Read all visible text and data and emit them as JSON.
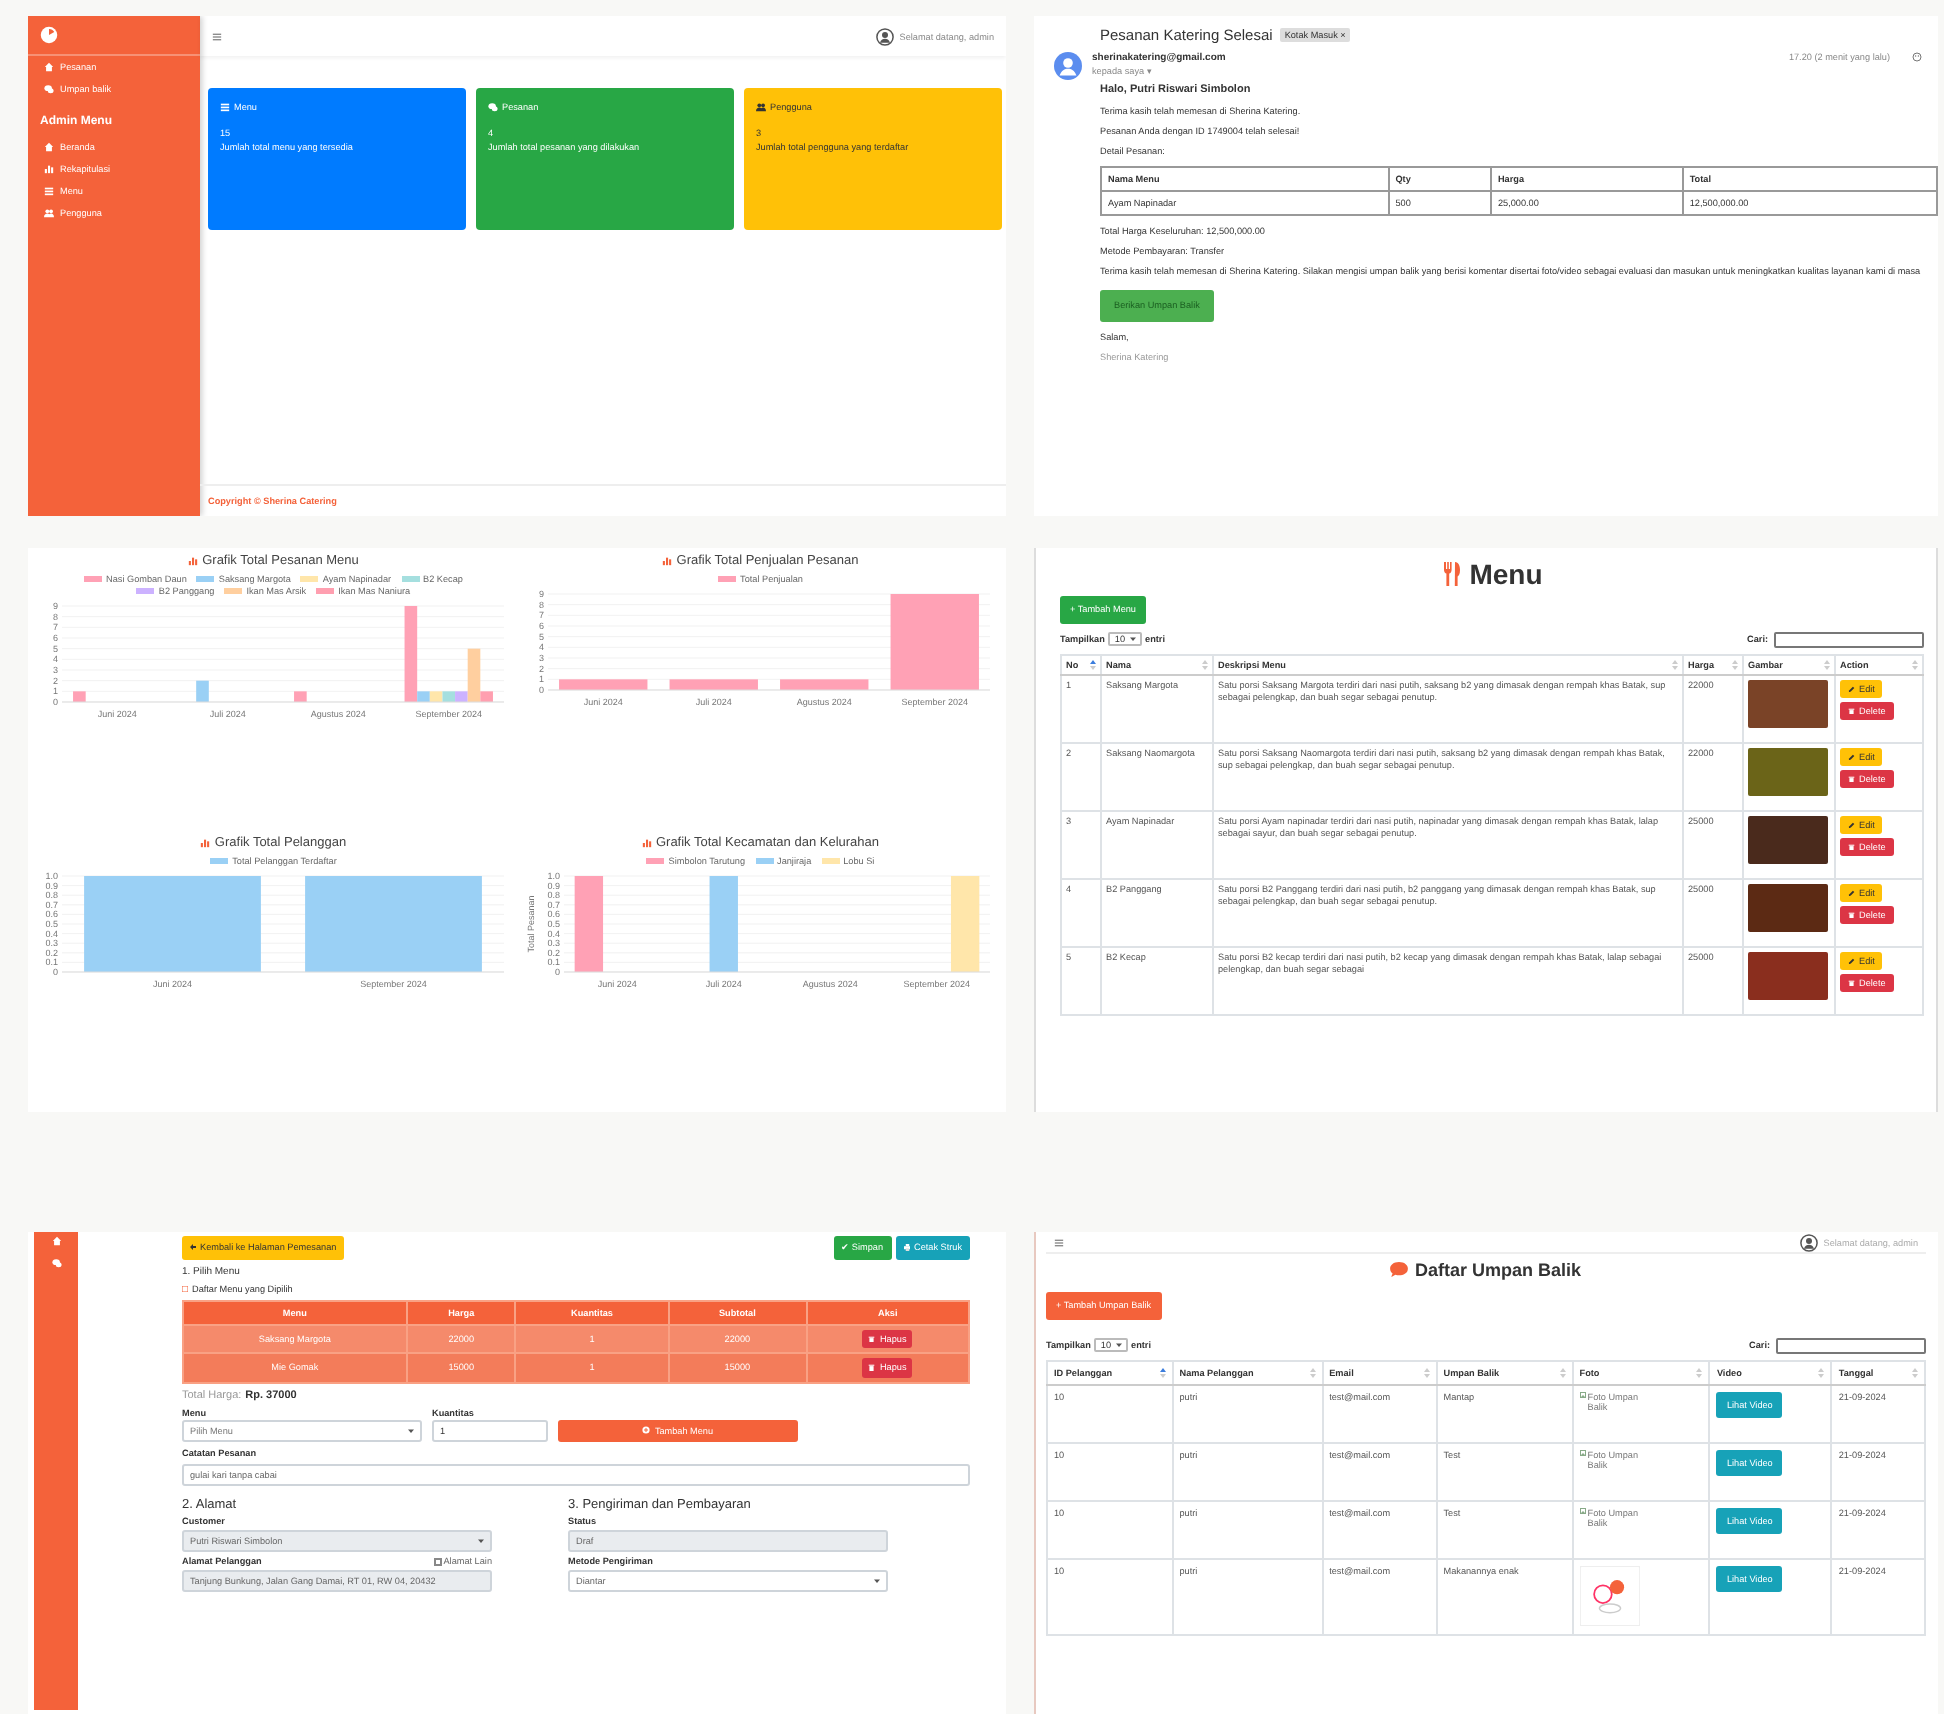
{
  "dashboard": {
    "sidebar": {
      "top_items": [
        "Pesanan",
        "Umpan balik"
      ],
      "section_title": "Admin Menu",
      "admin_items": [
        "Beranda",
        "Rekapitulasi",
        "Menu",
        "Pengguna"
      ]
    },
    "greeting": "Selamat datang, admin",
    "cards": [
      {
        "title": "Menu",
        "value": "15",
        "description": "Jumlah total menu yang tersedia",
        "color": "#007bff"
      },
      {
        "title": "Pesanan",
        "value": "4",
        "description": "Jumlah total pesanan yang dilakukan",
        "color": "#28a745"
      },
      {
        "title": "Pengguna",
        "value": "3",
        "description": "Jumlah total pengguna yang terdaftar",
        "color": "#ffc107"
      }
    ],
    "footer": "Copyright © Sherina Catering"
  },
  "email": {
    "subject": "Pesanan Katering Selesai",
    "label": "Kotak Masuk ×",
    "sender": "sherinakatering@gmail.com",
    "recipient": "kepada saya ▾",
    "time": "17.20 (2 menit yang lalu)",
    "greeting": "Halo, Putri Riswari Simbolon",
    "lines": [
      "Terima kasih telah memesan di Sherina Katering.",
      "Pesanan Anda dengan ID 1749004 telah selesai!",
      "Detail Pesanan:"
    ],
    "table": {
      "columns": [
        "Nama Menu",
        "Qty",
        "Harga",
        "Total"
      ],
      "rows": [
        [
          "Ayam Napinadar",
          "500",
          "25,000.00",
          "12,500,000.00"
        ]
      ]
    },
    "after_lines": [
      "Total Harga Keseluruhan: 12,500,000.00",
      "Metode Pembayaran: Transfer",
      "Terima kasih telah memesan di Sherina Katering. Silakan mengisi umpan balik yang berisi komentar disertai foto/video sebagai evaluasi dan masukan untuk meningkatkan kualitas layanan kami di masa"
    ],
    "button": "Berikan Umpan Balik",
    "closing": "Salam,",
    "signature": "Sherina Katering"
  },
  "charts": [
    {
      "chart_data": {
        "type": "bar",
        "title": "Grafik Total Pesanan Menu",
        "categories": [
          "Juni 2024",
          "Juli 2024",
          "Agustus 2024",
          "September 2024"
        ],
        "series": [
          {
            "name": "Nasi Gomban Daun",
            "color": "#ffa1b5",
            "values": [
              1,
              null,
              1,
              9
            ]
          },
          {
            "name": "Saksang Margota",
            "color": "#9ad0f5",
            "values": [
              null,
              2,
              null,
              1
            ]
          },
          {
            "name": "Ayam Napinadar",
            "color": "#ffe6aa",
            "values": [
              null,
              null,
              null,
              1
            ]
          },
          {
            "name": "B2 Kecap",
            "color": "#a5dfdf",
            "values": [
              null,
              null,
              null,
              1
            ]
          },
          {
            "name": "B2 Panggang",
            "color": "#ccb2ff",
            "values": [
              null,
              null,
              null,
              1
            ]
          },
          {
            "name": "Ikan Mas Arsik",
            "color": "#ffcf9f",
            "values": [
              null,
              null,
              null,
              5
            ]
          },
          {
            "name": "Ikan Mas Naniura",
            "color": "#ff9fb0",
            "values": [
              null,
              null,
              null,
              1
            ]
          }
        ],
        "ylim": [
          0,
          9
        ],
        "yticks": [
          0,
          1,
          2,
          3,
          4,
          5,
          6,
          7,
          8,
          9
        ],
        "legend": "top",
        "grid": true
      }
    },
    {
      "chart_data": {
        "type": "bar",
        "title": "Grafik Total Penjualan Pesanan",
        "categories": [
          "Juni 2024",
          "Juli 2024",
          "Agustus 2024",
          "September 2024"
        ],
        "series": [
          {
            "name": "Total Penjualan",
            "color": "#ffa1b5",
            "values": [
              1,
              1,
              1,
              9
            ]
          }
        ],
        "ylim": [
          0,
          9
        ],
        "yticks": [
          0,
          1,
          2,
          3,
          4,
          5,
          6,
          7,
          8,
          9
        ],
        "legend": "top",
        "grid": true
      }
    },
    {
      "chart_data": {
        "type": "bar",
        "title": "Grafik Total Pelanggan",
        "categories": [
          "Juni 2024",
          "September 2024"
        ],
        "series": [
          {
            "name": "Total Pelanggan Terdaftar",
            "color": "#9ad0f5",
            "values": [
              1,
              1
            ]
          }
        ],
        "ylim": [
          0,
          1
        ],
        "yticks": [
          0,
          0.1,
          0.2,
          0.3,
          0.4,
          0.5,
          0.6,
          0.7,
          0.8,
          0.9,
          {
            "value": 1,
            "label": "1.0"
          }
        ],
        "legend": "top",
        "grid": true
      }
    },
    {
      "chart_data": {
        "type": "bar",
        "title": "Grafik Total Kecamatan dan Kelurahan",
        "ylabel": "Total Pesanan",
        "categories": [
          "Juni 2024",
          "Juli 2024",
          "Agustus 2024",
          "September 2024"
        ],
        "series": [
          {
            "name": "Simbolon Tarutung",
            "color": "#ffa1b5",
            "values": [
              1,
              null,
              null,
              null
            ]
          },
          {
            "name": "Janjiraja",
            "color": "#9ad0f5",
            "values": [
              null,
              1,
              null,
              null
            ]
          },
          {
            "name": "Lobu Si",
            "color": "#ffe6aa",
            "values": [
              null,
              null,
              null,
              1
            ]
          }
        ],
        "ylim": [
          0,
          1
        ],
        "yticks": [
          0,
          0.1,
          0.2,
          0.3,
          0.4,
          0.5,
          0.6,
          0.7,
          0.8,
          0.9,
          {
            "value": 1,
            "label": "1.0"
          }
        ],
        "legend": "top",
        "grid": true
      }
    }
  ],
  "menu_page": {
    "title": "Menu",
    "add_button": "+ Tambah Menu",
    "show_label": "Tampilkan",
    "page_size": "10",
    "entries_label": "entri",
    "search_label": "Cari:",
    "columns": [
      {
        "label": "No",
        "sorted": true
      },
      {
        "label": "Nama",
        "sorted": false
      },
      {
        "label": "Deskripsi Menu",
        "sorted": false
      },
      {
        "label": "Harga",
        "sorted": false
      },
      {
        "label": "Gambar",
        "sorted": false
      },
      {
        "label": "Action",
        "sorted": false
      }
    ],
    "rows": [
      {
        "no": "1",
        "name": "Saksang Margota",
        "description": "Satu porsi Saksang Margota terdiri dari nasi putih, saksang b2 yang dimasak dengan rempah khas Batak, sup sebagai pelengkap, dan buah segar sebagai penutup.",
        "price": "22000",
        "edit": "Edit",
        "delete": "Delete"
      },
      {
        "no": "2",
        "name": "Saksang Naomargota",
        "description": "Satu porsi Saksang Naomargota terdiri dari nasi putih, saksang b2 yang dimasak dengan rempah khas Batak, sup sebagai pelengkap, dan buah segar sebagai penutup.",
        "price": "22000",
        "edit": "Edit",
        "delete": "Delete"
      },
      {
        "no": "3",
        "name": "Ayam Napinadar",
        "description": "Satu porsi Ayam napinadar terdiri dari nasi putih, napinadar yang dimasak dengan rempah khas Batak, lalap sebagai sayur, dan buah segar sebagai penutup.",
        "price": "25000",
        "edit": "Edit",
        "delete": "Delete"
      },
      {
        "no": "4",
        "name": "B2 Panggang",
        "description": "Satu porsi B2 Panggang terdiri dari nasi putih, b2 panggang yang dimasak dengan rempah khas Batak, sup sebagai pelengkap, dan buah segar sebagai penutup.",
        "price": "25000",
        "edit": "Edit",
        "delete": "Delete"
      },
      {
        "no": "5",
        "name": "B2 Kecap",
        "description": "Satu porsi B2 kecap terdiri dari nasi putih, b2 kecap yang dimasak dengan rempah khas Batak, lalap sebagai pelengkap, dan buah segar sebagai",
        "price": "25000",
        "edit": "Edit",
        "delete": "Delete"
      }
    ]
  },
  "order_form": {
    "back_button": "Kembali ke Halaman Pemesanan",
    "save_button": "✔ Simpan",
    "print_button": "Cetak Struk",
    "section_1": "1. Pilih Menu",
    "selected_title": "Daftar Menu yang Dipilih",
    "table": {
      "columns": [
        "Menu",
        "Harga",
        "Kuantitas",
        "Subtotal",
        "Aksi"
      ],
      "rows": [
        {
          "menu": "Saksang Margota",
          "price": "22000",
          "qty": "1",
          "subtotal": "22000",
          "action": "Hapus"
        },
        {
          "menu": "Mie Gomak",
          "price": "15000",
          "qty": "1",
          "subtotal": "15000",
          "action": "Hapus"
        }
      ]
    },
    "total_label": "Total Harga:",
    "total_value": "Rp. 37000",
    "menu_label": "Menu",
    "menu_select": "Pilih Menu",
    "qty_label": "Kuantitas",
    "qty_value": "1",
    "add_button": "Tambah Menu",
    "note_label": "Catatan Pesanan",
    "note_value": "gulai kari tanpa cabai",
    "section_2": "2. Alamat",
    "customer_label": "Customer",
    "customer_value": "Putri Riswari Simbolon",
    "address_label": "Alamat Pelanggan",
    "other_address": {
      "label": "Alamat Lain",
      "checked": false
    },
    "address_value": "Tanjung Bunkung, Jalan Gang Damai, RT 01, RW 04, 20432",
    "section_3": "3. Pengiriman dan Pembayaran",
    "status_label": "Status",
    "status_value": "Draf",
    "shipping_label": "Metode Pengiriman",
    "shipping_value": "Diantar"
  },
  "feedback_page": {
    "greeting": "Selamat datang, admin",
    "title": "Daftar Umpan Balik",
    "add_button": "+ Tambah Umpan Balik",
    "show_label": "Tampilkan",
    "page_size": "10",
    "entries_label": "entri",
    "search_label": "Cari:",
    "columns": [
      {
        "label": "ID Pelanggan",
        "sorted": true
      },
      {
        "label": "Nama Pelanggan",
        "sorted": false
      },
      {
        "label": "Email",
        "sorted": false
      },
      {
        "label": "Umpan Balik",
        "sorted": false
      },
      {
        "label": "Foto",
        "sorted": false
      },
      {
        "label": "Video",
        "sorted": false
      },
      {
        "label": "Tanggal",
        "sorted": false
      }
    ],
    "rows": [
      {
        "id": "10",
        "name": "putri",
        "email": "test@mail.com",
        "feedback": "Mantap",
        "photo": {
          "kind": "broken",
          "alt": "Foto Umpan Balik"
        },
        "video_button": "Lihat Video",
        "date": "21-09-2024"
      },
      {
        "id": "10",
        "name": "putri",
        "email": "test@mail.com",
        "feedback": "Test",
        "photo": {
          "kind": "broken",
          "alt": "Foto Umpan Balik"
        },
        "video_button": "Lihat Video",
        "date": "21-09-2024"
      },
      {
        "id": "10",
        "name": "putri",
        "email": "test@mail.com",
        "feedback": "Test",
        "photo": {
          "kind": "broken",
          "alt": "Foto Umpan Balik"
        },
        "video_button": "Lihat Video",
        "date": "21-09-2024"
      },
      {
        "id": "10",
        "name": "putri",
        "email": "test@mail.com",
        "feedback": "Makanannya enak",
        "photo": {
          "kind": "image"
        },
        "video_button": "Lihat Video",
        "date": "21-09-2024"
      }
    ]
  }
}
